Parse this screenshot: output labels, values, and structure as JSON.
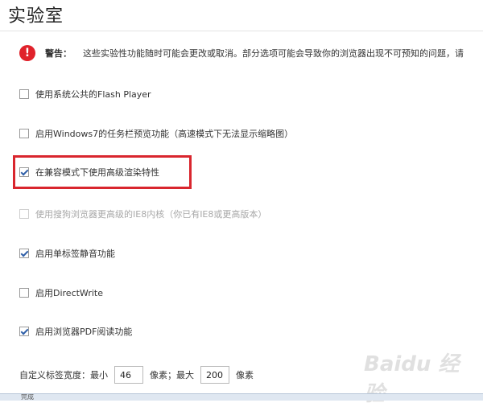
{
  "page": {
    "title": "实验室"
  },
  "warning": {
    "icon": "exclamation-icon",
    "label": "警告：",
    "text": "这些实验性功能随时可能会更改或取消。部分选项可能会导致你的浏览器出现不可预知的问题，请"
  },
  "options": [
    {
      "label": "使用系统公共的Flash Player",
      "checked": false,
      "disabled": false
    },
    {
      "label": "启用Windows7的任务栏预览功能（高速模式下无法显示缩略图）",
      "checked": false,
      "disabled": false
    },
    {
      "label": "在兼容模式下使用高级渲染特性",
      "checked": true,
      "disabled": false
    },
    {
      "label": "使用搜狗浏览器更高级的IE8内核（你已有IE8或更高版本）",
      "checked": false,
      "disabled": true
    },
    {
      "label": "启用单标签静音功能",
      "checked": true,
      "disabled": false
    },
    {
      "label": "启用DirectWrite",
      "checked": false,
      "disabled": false
    },
    {
      "label": "启用浏览器PDF阅读功能",
      "checked": true,
      "disabled": false
    }
  ],
  "tab_width": {
    "label": "自定义标签宽度：",
    "min_label": "最小",
    "min_value": "46",
    "unit_max_label": "像素；最大",
    "max_value": "200",
    "unit_label": "像素"
  },
  "status_bar": {
    "text": "完成"
  },
  "watermark": {
    "text": "Baidu 经验"
  },
  "colors": {
    "warning": "#e0222b",
    "highlight": "#d9262e",
    "check": "#2f5fa8"
  }
}
